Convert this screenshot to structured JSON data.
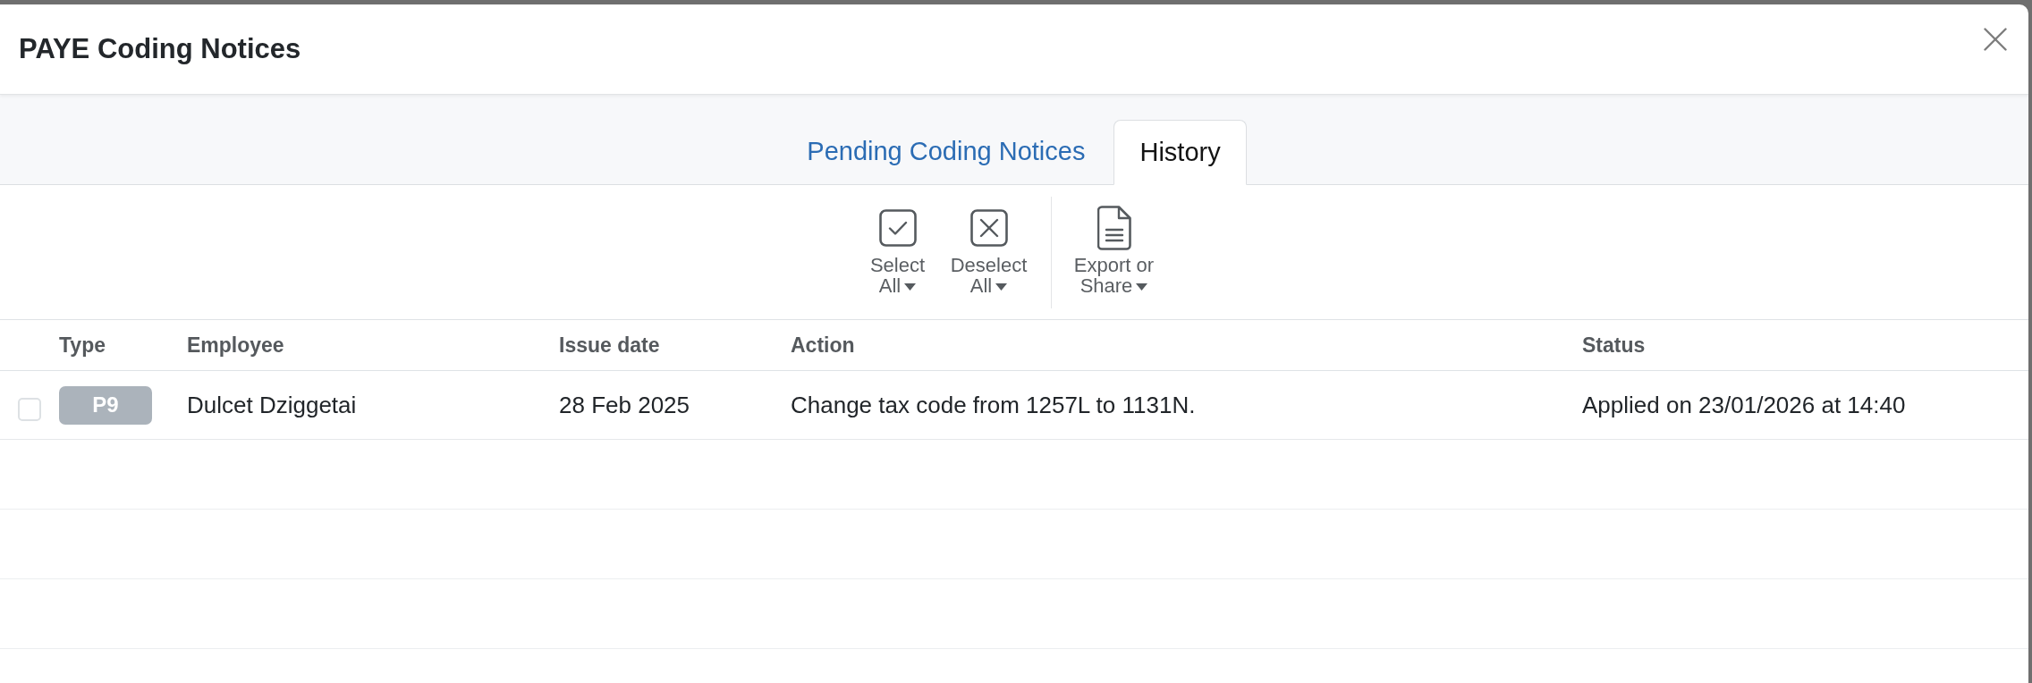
{
  "dialog": {
    "title": "PAYE Coding Notices"
  },
  "tabs": [
    {
      "label": "Pending Coding Notices",
      "selected": false
    },
    {
      "label": "History",
      "selected": true
    }
  ],
  "toolbar": [
    {
      "kind": "select_all",
      "label": "Select All"
    },
    {
      "kind": "deselect_all",
      "label": "Deselect All"
    },
    {
      "kind": "export",
      "label": "Export or Share"
    }
  ],
  "table": {
    "columns": [
      "Type",
      "Employee",
      "Issue date",
      "Action",
      "Status"
    ],
    "rows": [
      {
        "checked": false,
        "type": "P9",
        "employee": "Dulcet Dziggetai",
        "issue_date": "28 Feb 2025",
        "action": "Change tax code from 1257L to 1131N.",
        "status": "Applied on 23/01/2026 at 14:40"
      }
    ]
  }
}
